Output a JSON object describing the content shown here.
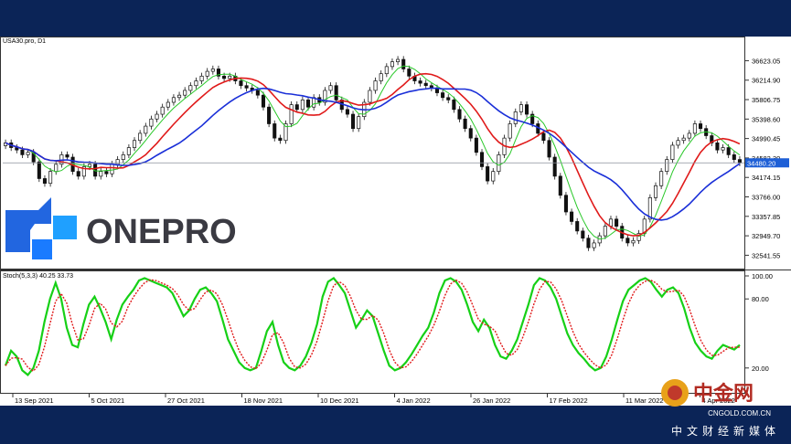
{
  "chart_data": [
    {
      "type": "candlestick",
      "title": "USA30.pro, D1",
      "symbol": "USA30.pro",
      "timeframe": "D1",
      "ylim": [
        32300,
        36900
      ],
      "yticks": [
        "36623.05",
        "36214.90",
        "35806.75",
        "35398.60",
        "34990.45",
        "34582.30",
        "34174.15",
        "33766.00",
        "33357.85",
        "32949.70",
        "32541.55"
      ],
      "current_price": "34480.20",
      "xticks": [
        "13 Sep 2021",
        "5 Oct 2021",
        "27 Oct 2021",
        "18 Nov 2021",
        "10 Dec 2021",
        "4 Jan 2022",
        "26 Jan 2022",
        "17 Feb 2022",
        "11 Mar 2022",
        "4 Apr 2022"
      ],
      "closes": [
        34900,
        34800,
        34750,
        34650,
        34700,
        34500,
        34150,
        34050,
        34300,
        34450,
        34650,
        34600,
        34300,
        34200,
        34400,
        34450,
        34200,
        34300,
        34250,
        34450,
        34550,
        34650,
        34800,
        34950,
        35100,
        35250,
        35400,
        35500,
        35650,
        35750,
        35850,
        35900,
        36000,
        36100,
        36200,
        36300,
        36400,
        36450,
        36300,
        36250,
        36300,
        36200,
        36100,
        36050,
        36000,
        35900,
        35650,
        35300,
        35000,
        34950,
        35300,
        35700,
        35600,
        35800,
        35650,
        35850,
        35750,
        36000,
        36100,
        35800,
        35600,
        35500,
        35200,
        35450,
        35750,
        36000,
        36200,
        36350,
        36500,
        36600,
        36650,
        36450,
        36300,
        36200,
        36150,
        36100,
        36050,
        35950,
        35850,
        35800,
        35600,
        35400,
        35200,
        35000,
        34700,
        34400,
        34100,
        34300,
        34650,
        35000,
        35300,
        35550,
        35700,
        35500,
        35300,
        35100,
        34950,
        34600,
        34200,
        33800,
        33450,
        33250,
        33050,
        32900,
        32700,
        32800,
        32950,
        33150,
        33300,
        33150,
        32900,
        32800,
        32850,
        33000,
        33300,
        33750,
        34000,
        34300,
        34550,
        34850,
        34950,
        35000,
        35100,
        35300,
        35200,
        35050,
        34900,
        34750,
        34800,
        34650,
        34550,
        34480
      ]
    },
    {
      "type": "line",
      "title": "Stoch(5,3,3) 40.25 33.73",
      "indicator": "Stoch(5,3,3)",
      "main_value": "40.25",
      "signal_value": "33.73",
      "ylim": [
        0,
        100
      ],
      "yticks": [
        "100.00",
        "80.00",
        "20.00"
      ],
      "k": [
        22,
        35,
        30,
        18,
        14,
        20,
        35,
        60,
        80,
        94,
        80,
        55,
        40,
        38,
        58,
        75,
        82,
        72,
        60,
        45,
        62,
        75,
        82,
        88,
        96,
        98,
        96,
        94,
        92,
        90,
        85,
        75,
        65,
        70,
        80,
        88,
        90,
        85,
        78,
        62,
        45,
        35,
        25,
        20,
        18,
        20,
        35,
        52,
        60,
        40,
        25,
        20,
        18,
        22,
        30,
        42,
        58,
        82,
        95,
        98,
        92,
        85,
        70,
        55,
        62,
        70,
        65,
        50,
        35,
        22,
        18,
        20,
        25,
        32,
        40,
        48,
        55,
        68,
        85,
        96,
        98,
        95,
        88,
        75,
        60,
        52,
        62,
        55,
        40,
        30,
        28,
        35,
        45,
        60,
        75,
        92,
        98,
        96,
        90,
        80,
        65,
        50,
        40,
        33,
        28,
        22,
        18,
        20,
        30,
        45,
        62,
        78,
        88,
        92,
        96,
        98,
        95,
        88,
        82,
        88,
        90,
        85,
        72,
        55,
        42,
        35,
        30,
        28,
        35,
        40,
        38,
        36,
        40
      ]
    }
  ],
  "watermark": {
    "brand": "ONEPRO"
  },
  "source_logo": {
    "name_cn": "中金网",
    "url": "CNGOLD.COM.CN",
    "tagline": "中文财经新媒体"
  },
  "colors": {
    "bull": "#111111",
    "ma_fast": "#28c828",
    "ma_mid": "#e01a1a",
    "ma_slow": "#1a2fd8",
    "stoch_main": "#16d016",
    "stoch_signal": "#e01a1a",
    "brand_blue": "#1e5fd6",
    "price_tag": "#1e5fd6"
  }
}
